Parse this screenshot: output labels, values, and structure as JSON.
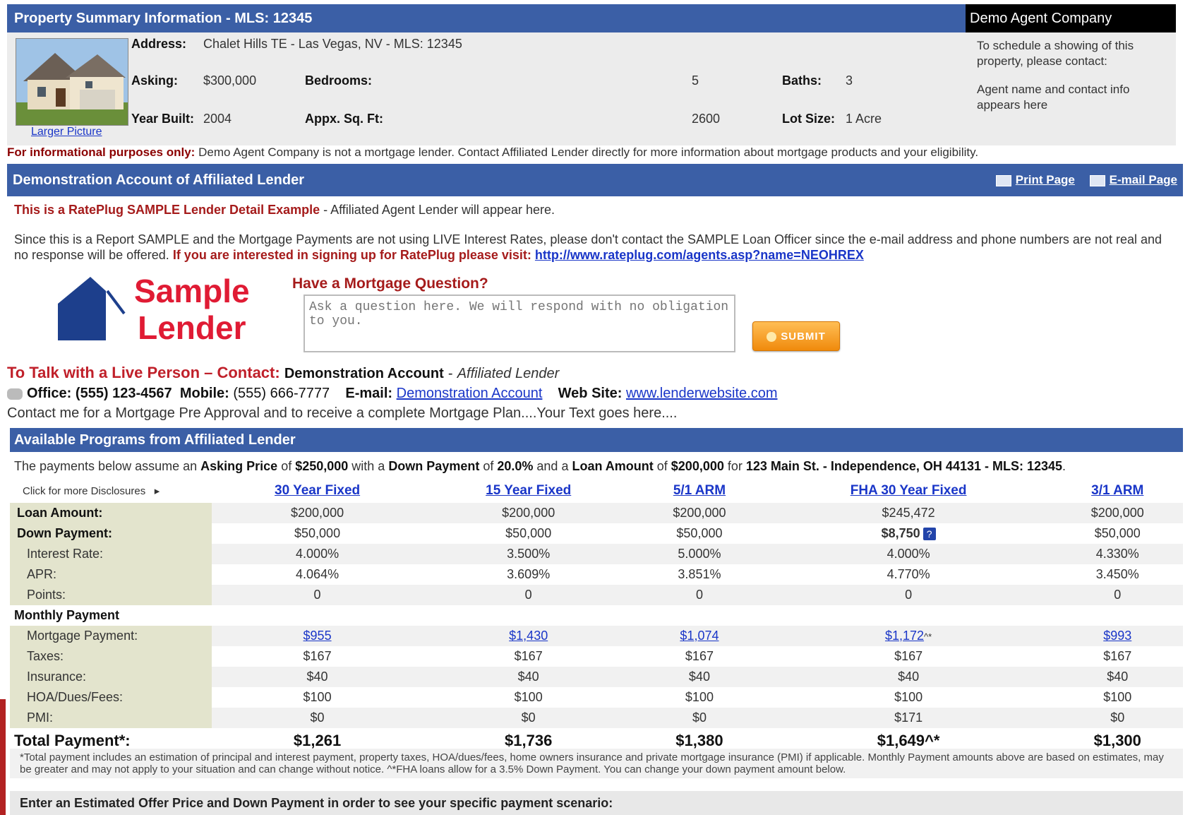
{
  "property": {
    "header_title": "Property Summary Information - MLS: 12345",
    "company": "Demo Agent Company",
    "address_label": "Address:",
    "address": "Chalet Hills TE - Las Vegas, NV - MLS: 12345",
    "asking_label": "Asking:",
    "asking": "$300,000",
    "bedrooms_label": "Bedrooms:",
    "bedrooms": "5",
    "baths_label": "Baths:",
    "baths": "3",
    "year_label": "Year Built:",
    "year": "2004",
    "sqft_label": "Appx. Sq. Ft:",
    "sqft": "2600",
    "lot_label": "Lot Size:",
    "lot": "1 Acre",
    "larger_picture": "Larger Picture",
    "schedule_1": "To schedule a showing of this property, please contact:",
    "schedule_2": "Agent name and contact info appears here"
  },
  "info_notice": {
    "bold": "For informational purposes only:",
    "text": " Demo Agent Company is not a mortgage lender. Contact Affiliated Lender directly for more information about mortgage products and your eligibility."
  },
  "demo": {
    "title": "Demonstration Account of Affiliated Lender",
    "print": "Print Page",
    "email": "E-mail Page",
    "sample_bold": "This is a RatePlug SAMPLE Lender Detail Example",
    "sample_rest": " - Affiliated Agent Lender will appear here.",
    "since_text": "Since this is a Report SAMPLE and the Mortgage Payments are not using LIVE Interest Rates, please don't contact the SAMPLE Loan Officer since the e-mail address and phone numbers are not real and no response will be offered. ",
    "since_bold": "If you are interested in signing up for RatePlug please visit: ",
    "since_link": "http://www.rateplug.com/agents.asp?name=NEOHREX"
  },
  "logo": {
    "line1": "Sample",
    "line2": "Lender",
    "color": "#e01b34"
  },
  "question": {
    "title": "Have a Mortgage Question?",
    "placeholder": "Ask a question here. We will respond with no obligation to you.",
    "submit": "SUBMIT"
  },
  "contact": {
    "talk_label": "To Talk with a Live Person – Contact:",
    "name": "Demonstration Account",
    "role": "Affiliated Lender",
    "office_label": "Office:",
    "office": "(555) 123-4567",
    "mobile_label": "Mobile:",
    "mobile": "(555) 666-7777",
    "email_label": "E-mail:",
    "email": "Demonstration Account",
    "web_label": "Web Site:",
    "web": "www.lenderwebsite.com",
    "note": "Contact me for a Mortgage Pre Approval and to receive a complete Mortgage Plan....Your Text goes here...."
  },
  "programs": {
    "title": "Available Programs from Affiliated Lender",
    "assume": {
      "t1": "The payments below assume an ",
      "b1": "Asking Price",
      "t2": " of ",
      "b2": "$250,000",
      "t3": " with a ",
      "b3": "Down Payment",
      "t4": " of ",
      "b4": "20.0%",
      "t5": " and a ",
      "b5": "Loan Amount",
      "t6": " of ",
      "b6": "$200,000",
      "t7": " for ",
      "b7": "123 Main St. - Independence, OH 44131 - MLS: 12345",
      "t8": "."
    },
    "disclosures": "Click for more Disclosures",
    "columns": [
      "30 Year Fixed",
      "15 Year Fixed",
      "5/1 ARM",
      "FHA 30 Year Fixed",
      "3/1 ARM"
    ],
    "rows": {
      "loan_amount": {
        "label": "Loan Amount:",
        "values": [
          "$200,000",
          "$200,000",
          "$200,000",
          "$245,472",
          "$200,000"
        ]
      },
      "down_payment": {
        "label": "Down Payment:",
        "values": [
          "$50,000",
          "$50,000",
          "$50,000",
          "$8,750",
          "$50,000"
        ]
      },
      "interest_rate": {
        "label": "Interest Rate:",
        "values": [
          "4.000%",
          "3.500%",
          "5.000%",
          "4.000%",
          "4.330%"
        ]
      },
      "apr": {
        "label": "APR:",
        "values": [
          "4.064%",
          "3.609%",
          "3.851%",
          "4.770%",
          "3.450%"
        ]
      },
      "points": {
        "label": "Points:",
        "values": [
          "0",
          "0",
          "0",
          "0",
          "0"
        ]
      },
      "monthly": {
        "label": "Monthly Payment"
      },
      "mortgage": {
        "label": "Mortgage Payment:",
        "values": [
          "$955",
          "$1,430",
          "$1,074",
          "$1,172",
          "$993"
        ],
        "fha_suffix": "^*"
      },
      "taxes": {
        "label": "Taxes:",
        "values": [
          "$167",
          "$167",
          "$167",
          "$167",
          "$167"
        ]
      },
      "insurance": {
        "label": "Insurance:",
        "values": [
          "$40",
          "$40",
          "$40",
          "$40",
          "$40"
        ]
      },
      "hoa": {
        "label": "HOA/Dues/Fees:",
        "values": [
          "$100",
          "$100",
          "$100",
          "$100",
          "$100"
        ]
      },
      "pmi": {
        "label": "PMI:",
        "values": [
          "$0",
          "$0",
          "$0",
          "$171",
          "$0"
        ]
      },
      "total": {
        "label": "Total Payment*:",
        "values": [
          "$1,261",
          "$1,736",
          "$1,380",
          "$1,649^*",
          "$1,300"
        ]
      }
    },
    "footnote": "*Total payment includes an estimation of principal and interest payment, property taxes, HOA/dues/fees, home owners insurance and private mortgage insurance (PMI) if applicable. Monthly Payment amounts above are based on estimates, may be greater and may not apply to your situation and can change without notice. ^*FHA loans allow for a 3.5% Down Payment. You can change your down payment amount below.",
    "enter": "Enter an Estimated Offer Price and Down Payment in order to see your specific payment scenario:"
  },
  "colors": {
    "header_blue": "#3b5fa6",
    "accent_red": "#a51b1b",
    "link_blue": "#1a36c8",
    "submit_orange": "#f08a0c"
  }
}
